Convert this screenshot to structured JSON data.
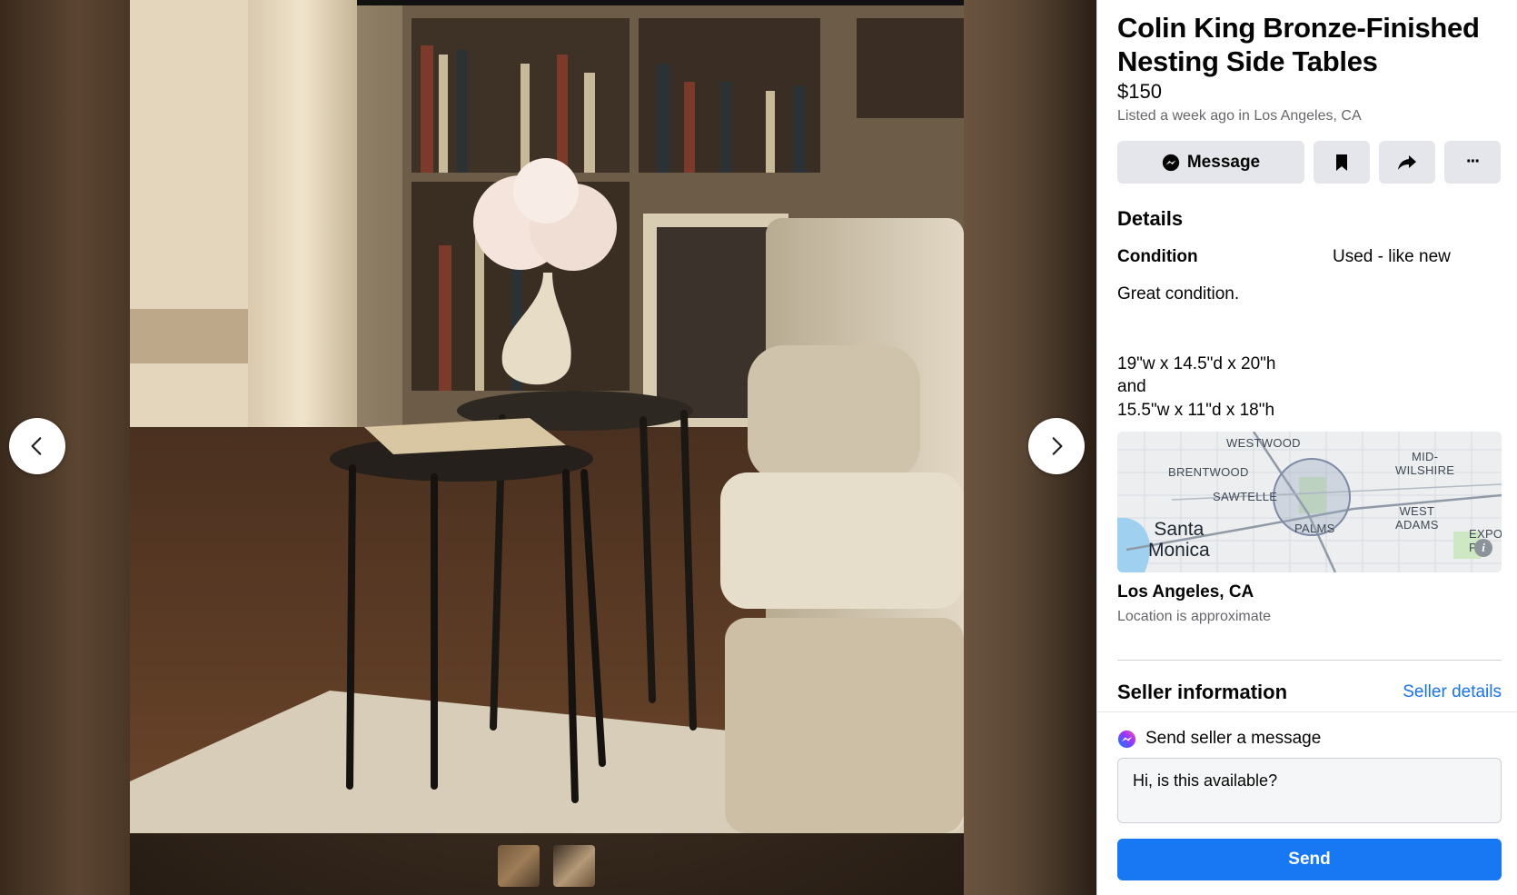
{
  "listing": {
    "title": "Colin King Bronze-Finished Nesting Side Tables",
    "price": "$150",
    "listed": "Listed a week ago in Los Angeles, CA"
  },
  "actions": {
    "message_label": "Message",
    "save_icon": "bookmark-icon",
    "share_icon": "share-icon",
    "more_icon": "more-icon",
    "more_glyph": "···"
  },
  "details": {
    "heading": "Details",
    "condition_label": "Condition",
    "condition_value": "Used - like new",
    "description": "Great condition.\n\n\n19\"w x 14.5\"d x 20\"h\nand\n15.5\"w x 11\"d x 18\"h"
  },
  "map": {
    "labels": [
      "WESTWOOD",
      "BRENTWOOD",
      "SAWTELLE",
      "MID-\nWILSHIRE",
      "WEST\nADAMS",
      "PALMS",
      "EXPO\nPA"
    ],
    "cities": [
      "Santa\nMonica"
    ],
    "info_icon": "info-icon"
  },
  "location": {
    "name": "Los Angeles, CA",
    "note": "Location is approximate"
  },
  "seller": {
    "heading": "Seller information",
    "details_link": "Seller details",
    "send_message_label": "Send seller a message",
    "message_value": "Hi, is this available?",
    "send_label": "Send"
  },
  "viewer": {
    "prev_icon": "chevron-left-icon",
    "next_icon": "chevron-right-icon",
    "thumbnail_count": 2
  },
  "colors": {
    "accent": "#1877f2",
    "link": "#1b74e4",
    "secondary_text": "#65676b"
  }
}
